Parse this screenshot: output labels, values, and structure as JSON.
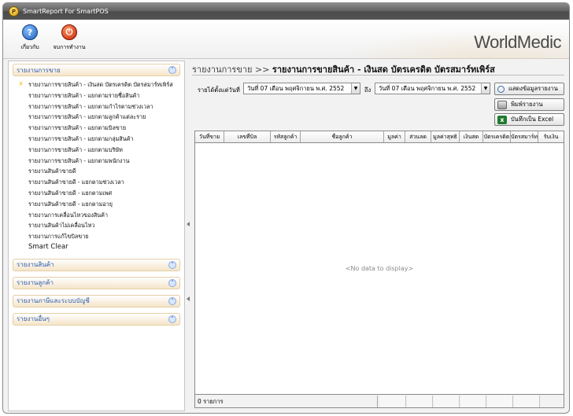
{
  "window": {
    "title": "SmartReport For SmartPOS"
  },
  "toolbar": {
    "help_label": "เกี่ยวกับ",
    "exit_label": "จบการทำงาน",
    "brand": "WorldMedic"
  },
  "sidebar": {
    "groups": [
      {
        "title": "รายงานการขาย",
        "expanded": true,
        "items": [
          "รายงานการขายสินค้า - เงินสด บัตรเครดิต บัตรสมาร์ทเพิร์ส",
          "รายงานการขายสินค้า - แยกตามรายชื่อสินค้า",
          "รายงานการขายสินค้า - แยกตามกำไรตามช่วงเวลา",
          "รายงานการขายสินค้า - แยกตามลูกค้าแต่ละราย",
          "รายงานการขายสินค้า - แยกตามบิลขาย",
          "รายงานการขายสินค้า - แยกตามกลุ่มสินค้า",
          "รายงานการขายสินค้า - แยกตามบริษัท",
          "รายงานการขายสินค้า - แยกตามพนักงาน",
          "รายงานสินค้าขายดี",
          "รายงานสินค้าขายดี - แยกตามช่วงเวลา",
          "รายงานสินค้าขายดี - แยกตามเพศ",
          "รายงานสินค้าขายดี - แยกตามอายุ",
          "รายงานการเคลื่อนไหวของสินค้า",
          "รายงานสินค้าไม่เคลื่อนไหว",
          "รายงานการแก้ไขบิลขาย",
          "Smart Clear"
        ]
      },
      {
        "title": "รายงานสินค้า",
        "expanded": false
      },
      {
        "title": "รายงานลูกค้า",
        "expanded": false
      },
      {
        "title": "รายงานภาษีและระบบบัญชี",
        "expanded": false
      },
      {
        "title": "รายงานอื่นๆ",
        "expanded": false
      }
    ]
  },
  "main": {
    "breadcrumb_section": "รายงานการขาย >>",
    "breadcrumb_current": "รายงานการขายสินค้า - เงินสด บัตรเครดิต บัตรสมาร์ทเพิร์ส",
    "filter": {
      "from_label": "รายได้ตั้งแต่วันที่",
      "from_value": "วันที่ 07 เดือน พฤศจิกายน พ.ศ. 2552",
      "to_label": "ถึง",
      "to_value": "วันที่ 07 เดือน พฤศจิกายน พ.ศ. 2552"
    },
    "buttons": {
      "show": "แสดงข้อมูลรายงาน",
      "print": "พิมพ์รายงาน",
      "excel": "บันทึกเป็น Excel"
    },
    "table": {
      "columns": [
        "วันที่ขาย",
        "เลขที่บิล",
        "รหัสลูกค้า",
        "ชื่อลูกค้า",
        "มูลค่า",
        "ส่วนลด",
        "มูลค่าสุทธิ",
        "เงินสด",
        "บัตรเครดิต",
        "บัตรสมาร์ทเพิร์ส",
        "รับเงิน"
      ],
      "empty_text": "<No data to display>",
      "footer_count": "0 รายการ"
    }
  },
  "colors": {
    "group_title": "#2a5db0",
    "titlebar": "#555555"
  }
}
